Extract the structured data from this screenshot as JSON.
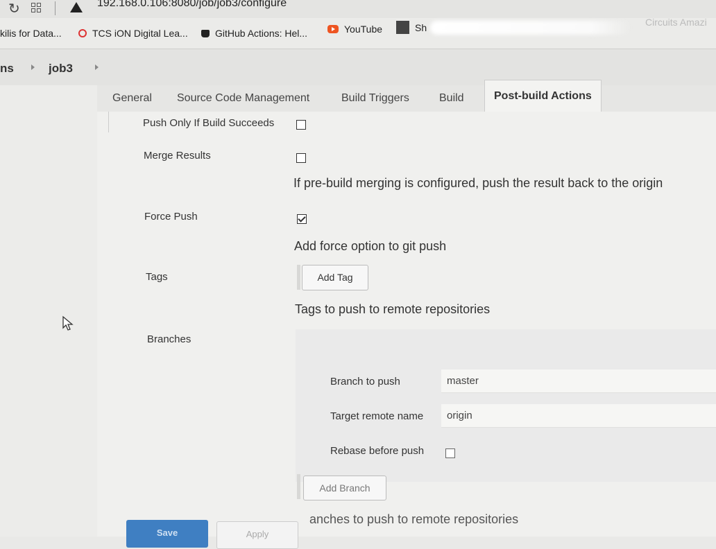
{
  "browser": {
    "url": "192.168.0.106:8080/job/job3/configure",
    "bookmarks": [
      "kilis for Data...",
      "TCS iON Digital Lea...",
      "GitHub Actions: Hel...",
      "YouTube",
      "Sh",
      "Circuits Amazi"
    ]
  },
  "breadcrumb": {
    "items": [
      "ns",
      "job3"
    ]
  },
  "tabs": [
    "General",
    "Source Code Management",
    "Build Triggers",
    "Build",
    "Post-build Actions"
  ],
  "active_tab": "Post-build Actions",
  "form": {
    "push_only_label": "Push Only If Build Succeeds",
    "merge_results_label": "Merge Results",
    "merge_results_help": "If pre-build merging is configured, push the result back to the origin",
    "force_push_label": "Force Push",
    "force_push_checked": true,
    "force_push_help": "Add force option to git push",
    "tags_label": "Tags",
    "add_tag_button": "Add Tag",
    "tags_help": "Tags to push to remote repositories",
    "branches_label": "Branches",
    "branch_to_push_label": "Branch to push",
    "branch_to_push_value": "master",
    "target_remote_label": "Target remote name",
    "target_remote_value": "origin",
    "rebase_label": "Rebase before push",
    "add_branch_button": "Add Branch",
    "branches_help": "anches to push to remote repositories"
  },
  "footer": {
    "save": "Save",
    "apply": "Apply"
  },
  "colors": {
    "save_bg": "#3f7fc2",
    "page_bg": "#f0f0ee"
  }
}
